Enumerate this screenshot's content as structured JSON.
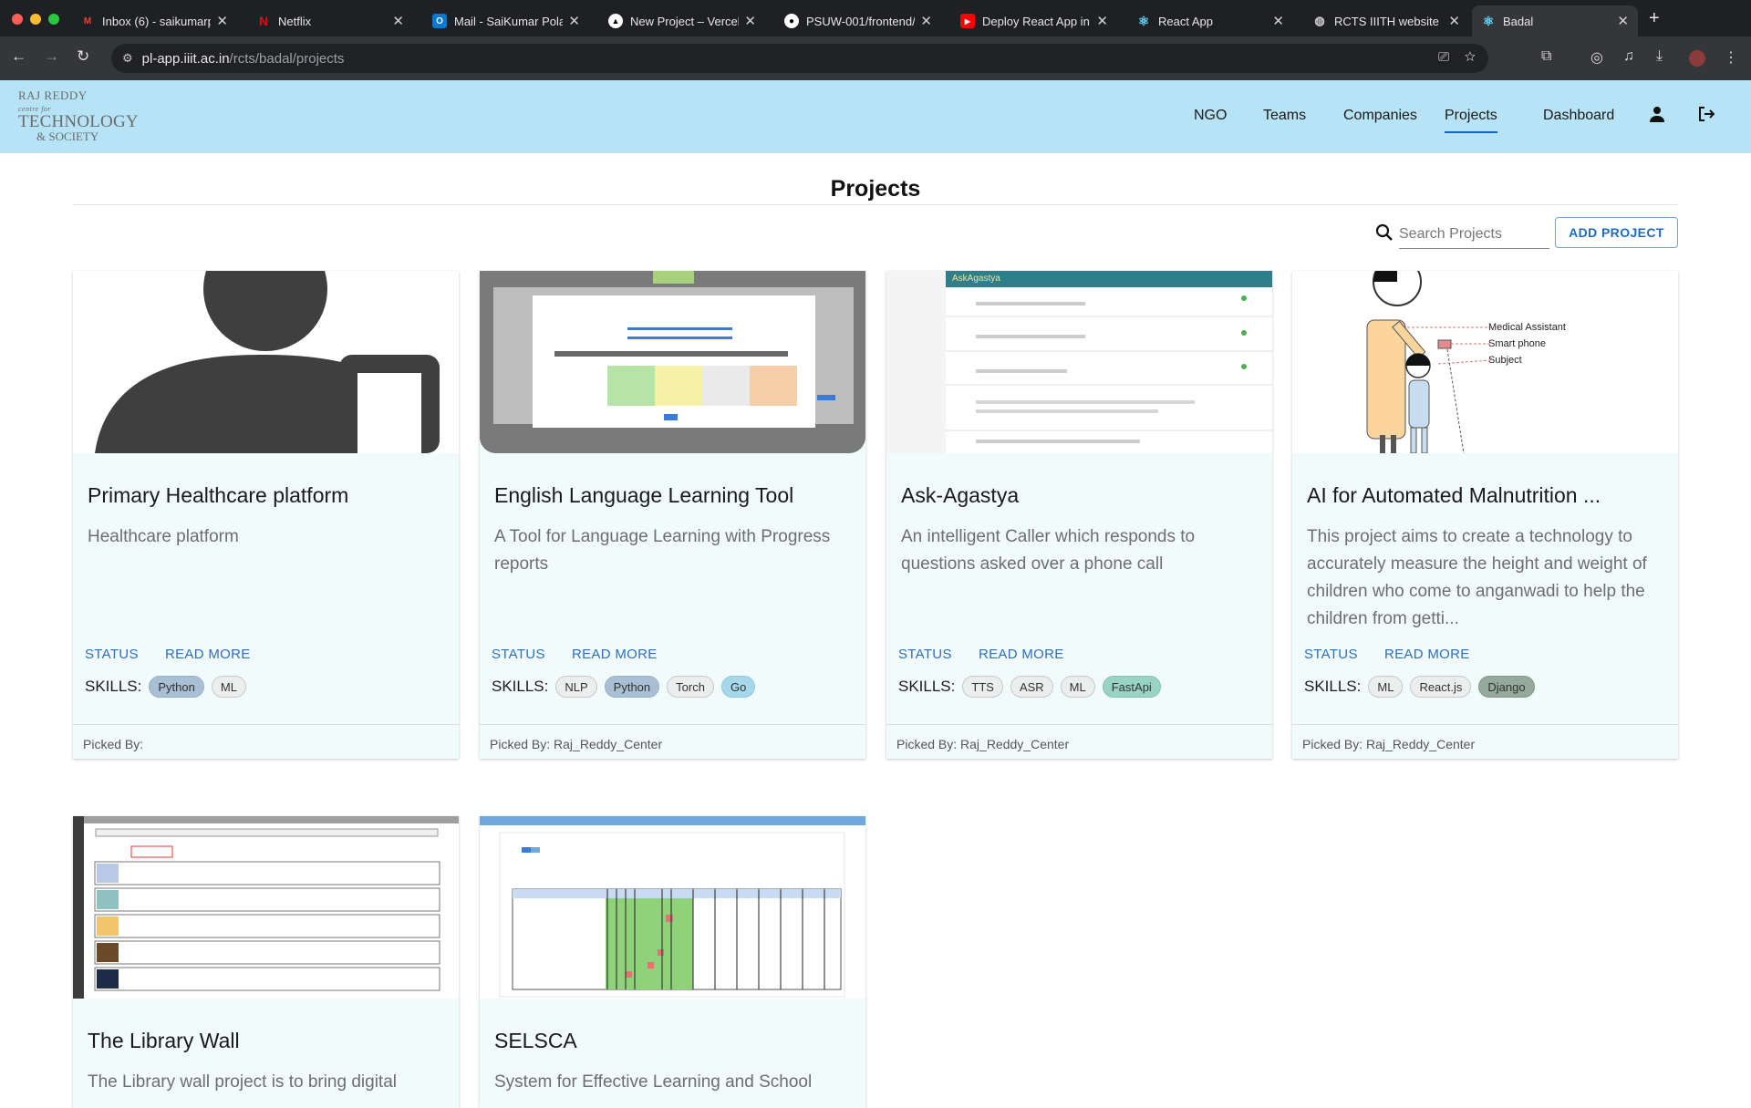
{
  "browser": {
    "tabs": [
      {
        "title": "Inbox (6) - saikumarp",
        "icon": "gmail-icon",
        "color": "#ea4335"
      },
      {
        "title": "Netflix",
        "icon": "netflix-icon",
        "color": "#e50914"
      },
      {
        "title": "Mail - SaiKumar Pola",
        "icon": "outlook-icon",
        "color": "#0078d4"
      },
      {
        "title": "New Project – Vercel",
        "icon": "vercel-icon",
        "color": "#ffffff"
      },
      {
        "title": "PSUW-001/frontend/",
        "icon": "github-icon",
        "color": "#ffffff"
      },
      {
        "title": "Deploy React App in",
        "icon": "youtube-icon",
        "color": "#ff0000"
      },
      {
        "title": "React App",
        "icon": "react-icon",
        "color": "#61dafb"
      },
      {
        "title": "RCTS IIITH website",
        "icon": "globe-icon",
        "color": "#cfcfcf"
      },
      {
        "title": "Badal",
        "icon": "react-icon",
        "color": "#61dafb"
      }
    ],
    "url_host": "pl-app.iiit.ac.in",
    "url_path": "/rcts/badal/projects"
  },
  "header": {
    "logo": {
      "line1": "RAJ REDDY",
      "line1_small": "centre for",
      "line2": "TECHNOLOGY",
      "line3": "& SOCIETY"
    },
    "nav": [
      "NGO",
      "Teams",
      "Companies",
      "Projects",
      "Dashboard"
    ],
    "active_nav": "Projects"
  },
  "page": {
    "title": "Projects",
    "search_placeholder": "Search Projects",
    "add_button": "ADD PROJECT"
  },
  "card_common": {
    "status_label": "STATUS",
    "read_more_label": "READ MORE",
    "skills_label": "SKILLS:",
    "picked_by_label": "Picked By:"
  },
  "projects": [
    {
      "title": "Primary Healthcare platform",
      "description": "Healthcare platform",
      "skills": [
        {
          "name": "Python",
          "color": "#a9bfd4"
        },
        {
          "name": "ML",
          "color": "#eceeee"
        }
      ],
      "picked_by": "",
      "image": "person-placeholder"
    },
    {
      "title": "English Language Learning Tool",
      "description": "A Tool for Language Learning with Progress reports",
      "skills": [
        {
          "name": "NLP",
          "color": "#eceeee"
        },
        {
          "name": "Python",
          "color": "#a9bfd4"
        },
        {
          "name": "Torch",
          "color": "#eceeee"
        },
        {
          "name": "Go",
          "color": "#a6d8ec"
        }
      ],
      "picked_by": "Raj_Reddy_Center",
      "image": "result-screenshot"
    },
    {
      "title": "Ask-Agastya",
      "description": "An intelligent Caller which responds to questions asked over a phone call",
      "skills": [
        {
          "name": "TTS",
          "color": "#eceeee"
        },
        {
          "name": "ASR",
          "color": "#eceeee"
        },
        {
          "name": "ML",
          "color": "#eceeee"
        },
        {
          "name": "FastApi",
          "color": "#99d3c4"
        }
      ],
      "picked_by": "Raj_Reddy_Center",
      "image": "agastya-screenshot",
      "image_header": "AskAgastya"
    },
    {
      "title": "AI for Automated Malnutrition ...",
      "description": "This project aims to create a technology to accurately measure the height and weight of children who come to anganwadi to help the children from getti...",
      "skills": [
        {
          "name": "ML",
          "color": "#eceeee"
        },
        {
          "name": "React.js",
          "color": "#eceeee"
        },
        {
          "name": "Django",
          "color": "#95aa9a"
        }
      ],
      "picked_by": "Raj_Reddy_Center",
      "image": "malnutrition-diagram",
      "diagram_labels": [
        "Medical Assistant",
        "Smart phone",
        "Subject"
      ]
    },
    {
      "title": "The Library Wall",
      "description": "The Library wall project is to bring digital",
      "skills": [],
      "picked_by": "",
      "image": "library-screenshot"
    },
    {
      "title": "SELSCA",
      "description": "System for Effective Learning and School",
      "skills": [],
      "picked_by": "",
      "image": "selsca-screenshot"
    }
  ]
}
